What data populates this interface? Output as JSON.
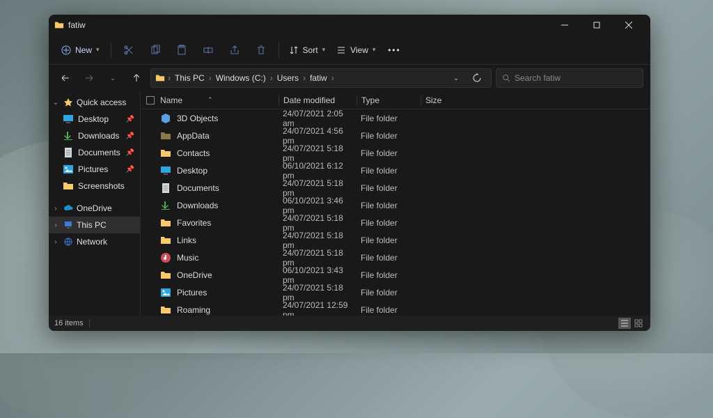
{
  "window_title": "fatiw",
  "toolbar": {
    "new_label": "New",
    "sort_label": "Sort",
    "view_label": "View"
  },
  "breadcrumbs": [
    "This PC",
    "Windows (C:)",
    "Users",
    "fatiw"
  ],
  "search_placeholder": "Search fatiw",
  "nav": {
    "quick_access": "Quick access",
    "quick_items": [
      {
        "label": "Desktop",
        "icon": "desktop",
        "pin": true
      },
      {
        "label": "Downloads",
        "icon": "download",
        "pin": true
      },
      {
        "label": "Documents",
        "icon": "document",
        "pin": true
      },
      {
        "label": "Pictures",
        "icon": "picture",
        "pin": true
      },
      {
        "label": "Screenshots",
        "icon": "folder",
        "pin": false
      }
    ],
    "onedrive": "OneDrive",
    "this_pc": "This PC",
    "network": "Network"
  },
  "columns": {
    "name": "Name",
    "date": "Date modified",
    "type": "Type",
    "size": "Size"
  },
  "files": [
    {
      "name": "3D Objects",
      "icon": "cube",
      "date": "24/07/2021 2:05 am",
      "type": "File folder"
    },
    {
      "name": "AppData",
      "icon": "folder-muted",
      "date": "24/07/2021 4:56 pm",
      "type": "File folder"
    },
    {
      "name": "Contacts",
      "icon": "folder",
      "date": "24/07/2021 5:18 pm",
      "type": "File folder"
    },
    {
      "name": "Desktop",
      "icon": "desktop",
      "date": "06/10/2021 6:12 pm",
      "type": "File folder"
    },
    {
      "name": "Documents",
      "icon": "document",
      "date": "24/07/2021 5:18 pm",
      "type": "File folder"
    },
    {
      "name": "Downloads",
      "icon": "download",
      "date": "06/10/2021 3:46 pm",
      "type": "File folder"
    },
    {
      "name": "Favorites",
      "icon": "folder",
      "date": "24/07/2021 5:18 pm",
      "type": "File folder"
    },
    {
      "name": "Links",
      "icon": "folder",
      "date": "24/07/2021 5:18 pm",
      "type": "File folder"
    },
    {
      "name": "Music",
      "icon": "music",
      "date": "24/07/2021 5:18 pm",
      "type": "File folder"
    },
    {
      "name": "OneDrive",
      "icon": "folder",
      "date": "06/10/2021 3:43 pm",
      "type": "File folder"
    },
    {
      "name": "Pictures",
      "icon": "picture",
      "date": "24/07/2021 5:18 pm",
      "type": "File folder"
    },
    {
      "name": "Roaming",
      "icon": "folder",
      "date": "24/07/2021 12:59 pm",
      "type": "File folder"
    }
  ],
  "status": {
    "count": "16 items"
  }
}
